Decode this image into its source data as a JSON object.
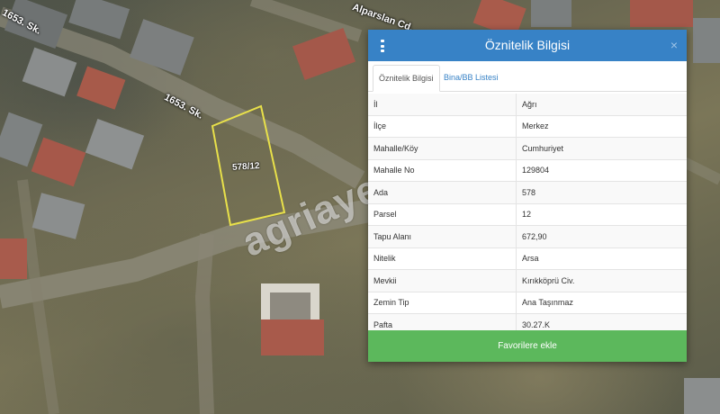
{
  "map": {
    "watermark": "agriayemlak",
    "streets": [
      "1653. Sk.",
      "1653. Sk.",
      "Alparslan Cd."
    ],
    "parcel_label": "578/12"
  },
  "panel": {
    "title": "Öznitelik Bilgisi",
    "close_icon": "×",
    "tabs": [
      "Öznitelik Bilgisi",
      "Bina/BB Listesi"
    ],
    "rows": [
      {
        "key": "İl",
        "value": "Ağrı"
      },
      {
        "key": "İlçe",
        "value": "Merkez"
      },
      {
        "key": "Mahalle/Köy",
        "value": "Cumhuriyet"
      },
      {
        "key": "Mahalle No",
        "value": "129804"
      },
      {
        "key": "Ada",
        "value": "578"
      },
      {
        "key": "Parsel",
        "value": "12"
      },
      {
        "key": "Tapu Alanı",
        "value": "672,90"
      },
      {
        "key": "Nitelik",
        "value": "Arsa"
      },
      {
        "key": "Mevkii",
        "value": "Kırıkköprü Civ."
      },
      {
        "key": "Zemin Tip",
        "value": "Ana Taşınmaz"
      },
      {
        "key": "Pafta",
        "value": "30.27.K"
      }
    ],
    "favorite_button": "Favorilere ekle",
    "colors": {
      "header": "#3782c6",
      "button": "#5cb85c"
    }
  }
}
